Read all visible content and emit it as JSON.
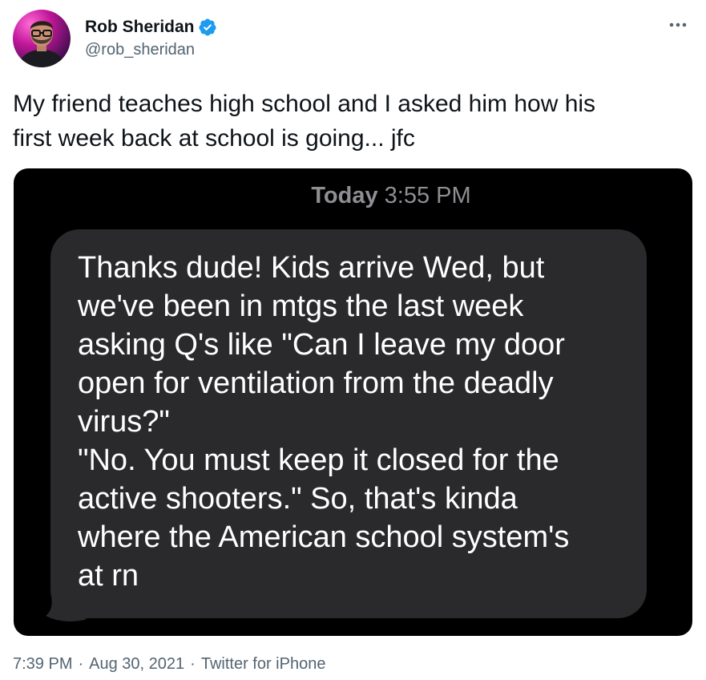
{
  "author": {
    "display_name": "Rob Sheridan",
    "handle": "@rob_sheridan",
    "verified": true,
    "avatar_icon": "profile-photo",
    "verified_icon": "verified-badge-icon",
    "verified_color": "#1d9bf0"
  },
  "tweet": {
    "text": "My friend teaches high school and I asked him how his\nfirst week back at school is going... jfc"
  },
  "media": {
    "timestamp_day": "Today",
    "timestamp_time": "3:55 PM",
    "message_text": "Thanks dude! Kids arrive Wed, but\nwe've been in mtgs the last week\nasking Q's like \"Can I leave my door\nopen for ventilation from the deadly\nvirus?\"\n\"No. You must keep it closed for the\nactive shooters.\" So, that's kinda\nwhere the American school system's\nat rn",
    "bubble_color": "#2a2a2c",
    "background_color": "#000000"
  },
  "meta": {
    "time": "7:39 PM",
    "date": "Aug 30, 2021",
    "source": "Twitter for iPhone",
    "separator": "·"
  },
  "menu": {
    "more_icon": "more-horizontal-icon"
  }
}
